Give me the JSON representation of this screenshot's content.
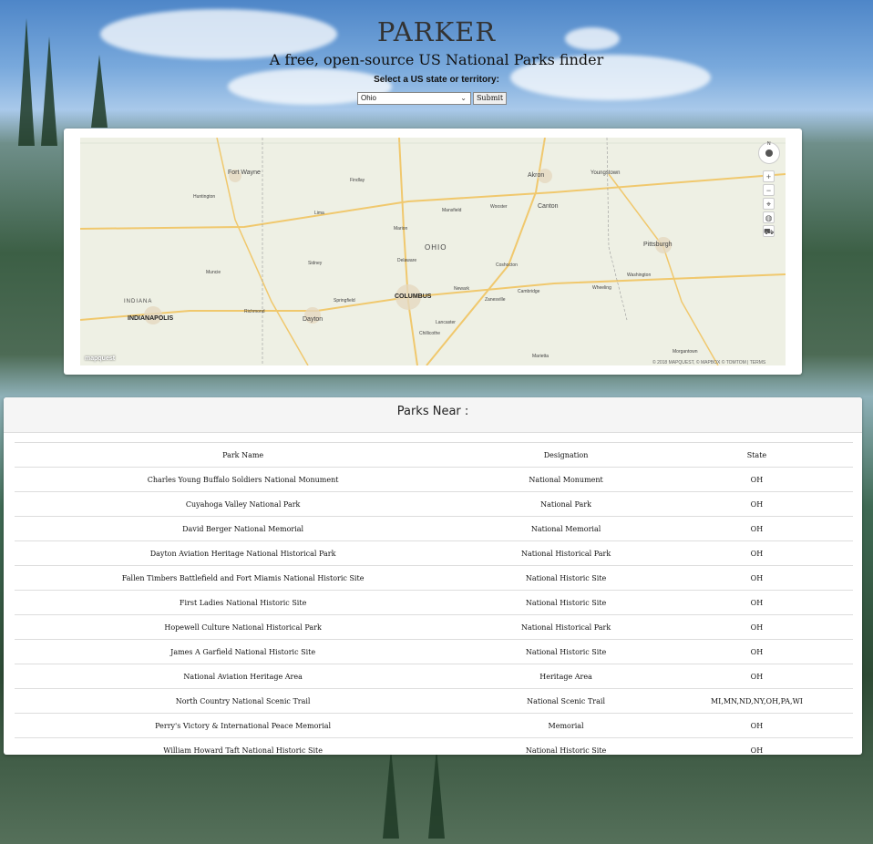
{
  "app": {
    "title": "PARKER",
    "tagline": "A free, open-source US National Parks finder"
  },
  "form": {
    "label": "Select a US state or territory:",
    "selected_state": "Ohio",
    "submit_label": "Submit"
  },
  "map": {
    "state_label": "OHIO",
    "cities": [
      {
        "name": "Fort Wayne"
      },
      {
        "name": "Akron"
      },
      {
        "name": "Canton"
      },
      {
        "name": "Youngstown"
      },
      {
        "name": "Pittsburgh"
      },
      {
        "name": "COLUMBUS"
      },
      {
        "name": "INDIANAPOLIS"
      },
      {
        "name": "Dayton"
      },
      {
        "name": "Huntington"
      },
      {
        "name": "Lima"
      },
      {
        "name": "Mansfield"
      },
      {
        "name": "Wooster"
      },
      {
        "name": "Zanesville"
      },
      {
        "name": "Marion"
      },
      {
        "name": "Newark"
      },
      {
        "name": "Chillicothe"
      },
      {
        "name": "Lancaster"
      },
      {
        "name": "Wheeling"
      },
      {
        "name": "Springfield"
      },
      {
        "name": "Washington"
      },
      {
        "name": "Richmond"
      },
      {
        "name": "Muncie"
      },
      {
        "name": "Findlay"
      },
      {
        "name": "Coshocton"
      },
      {
        "name": "Cambridge"
      },
      {
        "name": "Marietta"
      },
      {
        "name": "Morgantown"
      },
      {
        "name": "INDIANA"
      },
      {
        "name": "Delaware"
      },
      {
        "name": "Sidney"
      }
    ],
    "attribution": "© 2018 MAPQUEST, © MAPBOX © TOMTOM | TERMS",
    "logo": "mapquest",
    "compass_label": "N"
  },
  "parks": {
    "heading": "Parks Near :",
    "columns": [
      "Park Name",
      "Designation",
      "State"
    ],
    "rows": [
      [
        "Charles Young Buffalo Soldiers National Monument",
        "National Monument",
        "OH"
      ],
      [
        "Cuyahoga Valley National Park",
        "National Park",
        "OH"
      ],
      [
        "David Berger National Memorial",
        "National Memorial",
        "OH"
      ],
      [
        "Dayton Aviation Heritage National Historical Park",
        "National Historical Park",
        "OH"
      ],
      [
        "Fallen Timbers Battlefield and Fort Miamis National Historic Site",
        "National Historic Site",
        "OH"
      ],
      [
        "First Ladies National Historic Site",
        "National Historic Site",
        "OH"
      ],
      [
        "Hopewell Culture National Historical Park",
        "National Historical Park",
        "OH"
      ],
      [
        "James A Garfield National Historic Site",
        "National Historic Site",
        "OH"
      ],
      [
        "National Aviation Heritage Area",
        "Heritage Area",
        "OH"
      ],
      [
        "North Country National Scenic Trail",
        "National Scenic Trail",
        "MI,MN,ND,NY,OH,PA,WI"
      ],
      [
        "Perry's Victory & International Peace Memorial",
        "Memorial",
        "OH"
      ],
      [
        "William Howard Taft National Historic Site",
        "National Historic Site",
        "OH"
      ]
    ]
  }
}
